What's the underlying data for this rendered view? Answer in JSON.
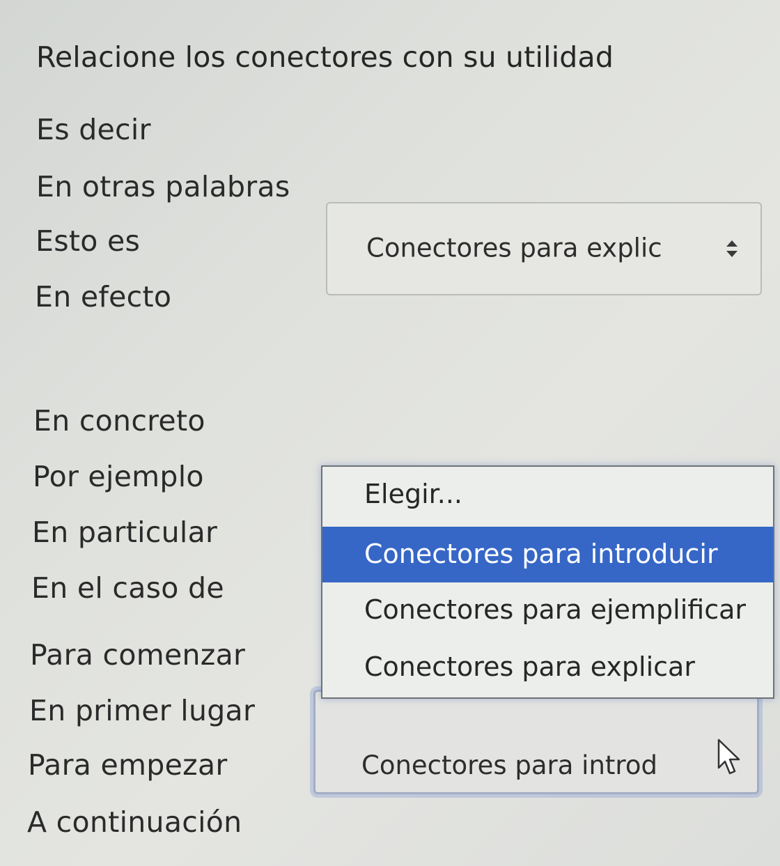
{
  "question": "Relacione los conectores con su utilidad",
  "terms": [
    "Es decir",
    "En otras palabras",
    "Esto es",
    "En efecto",
    "En concreto",
    "Por ejemplo",
    "En particular",
    "En el caso de",
    "Para comenzar",
    "En primer lugar",
    "Para empezar",
    "A continuación"
  ],
  "select_explicar": {
    "value": "Conectores para explic",
    "icon": "up-down-arrows-icon"
  },
  "dropdown": {
    "options": [
      "Elegir...",
      "Conectores para introducir",
      "Conectores para ejemplificar",
      "Conectores para explicar"
    ],
    "highlighted": "Conectores para introducir",
    "highlight_color": "#3667c6"
  },
  "select_introducir": {
    "value": "Conectores para introd"
  },
  "colors": {
    "background": "#e0e2de",
    "focus_ring": "#96a8d2"
  }
}
